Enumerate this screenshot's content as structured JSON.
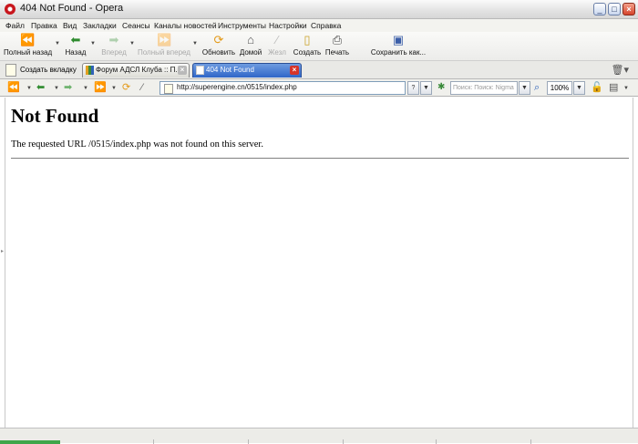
{
  "window": {
    "title": "404 Not Found - Opera"
  },
  "menu": [
    "Файл",
    "Правка",
    "Вид",
    "Закладки",
    "Сеансы",
    "Каналы новостей",
    "Инструменты",
    "Настройки",
    "Справка"
  ],
  "toolbar": {
    "rewind": "Полный назад",
    "back": "Назад",
    "forward": "Вперед",
    "fast_forward": "Полный вперед",
    "reload": "Обновить",
    "home": "Домой",
    "wand": "Жезл",
    "create": "Создать",
    "print": "Печать",
    "save_as": "Сохранить как..."
  },
  "tabs": {
    "new_tab": "Создать вкладку",
    "items": [
      {
        "label": "Форум АДСЛ Клуба :: П...",
        "active": false
      },
      {
        "label": "404 Not Found",
        "active": true
      }
    ]
  },
  "address": {
    "url": "http://superengine.cn/0515/index.php"
  },
  "search": {
    "placeholder": "Поиск: Поиск: Nigma"
  },
  "zoom": {
    "level": "100%"
  },
  "page": {
    "heading": "Not Found",
    "message": "The requested URL /0515/index.php was not found on this server."
  },
  "colors": {
    "active_tab": "#2f66c8",
    "close_button": "#d5432b",
    "progress": "#3fa64a"
  }
}
